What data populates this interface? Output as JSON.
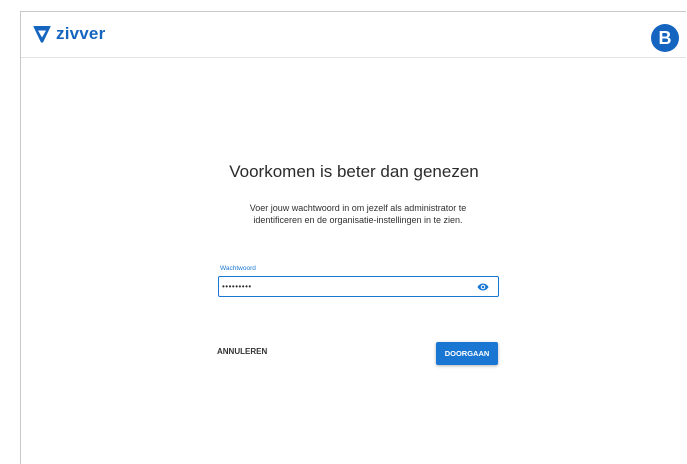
{
  "header": {
    "logo_text": "zivver",
    "avatar_initial": "B"
  },
  "login": {
    "title": "Voorkomen is beter dan genezen",
    "description": "Voer jouw wachtwoord in om jezelf als administrator te identificeren en de organisatie-instellingen in te zien.",
    "password_label": "Wachtwoord",
    "password_value": "•••••••••",
    "cancel_label": "ANNULEREN",
    "confirm_label": "DOORGAAN"
  },
  "colors": {
    "brand": "#1565c0",
    "accent": "#1976d2"
  },
  "icons": {
    "logo": "zivver-logo-icon",
    "password_toggle": "eye-icon"
  }
}
